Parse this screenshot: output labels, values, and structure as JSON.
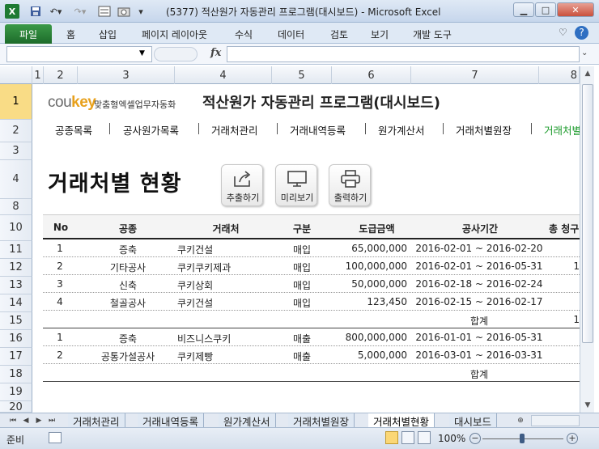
{
  "window": {
    "title": "(5377) 적산원가 자동관리 프로그램(대시보드) - Microsoft Excel",
    "icon": "excel-icon"
  },
  "ribbon": {
    "file_tab": "파일",
    "tabs": [
      "홈",
      "삽입",
      "페이지 레이아웃",
      "수식",
      "데이터",
      "검토",
      "보기",
      "개발 도구"
    ]
  },
  "formula_bar": {
    "fx": "fx",
    "name_box": "",
    "value": ""
  },
  "columns": [
    "1",
    "2",
    "3",
    "4",
    "5",
    "6",
    "7",
    "8"
  ],
  "rows": [
    "1",
    "2",
    "3",
    "4",
    "8",
    "10",
    "11",
    "12",
    "13",
    "14",
    "15",
    "16",
    "17",
    "18",
    "19",
    "20"
  ],
  "header": {
    "logo_main": "cou",
    "logo_accent": "key",
    "logo_sub": "맞춤형엑셀업무자동화",
    "title": "적산원가 자동관리 프로그램(대시보드)"
  },
  "menu": [
    "공종목록",
    "공사원가목록",
    "거래처관리",
    "거래내역등록",
    "원가계산서",
    "거래처별원장",
    "거래처별"
  ],
  "page_title": "거래처별 현황",
  "actions": {
    "export": "추출하기",
    "preview": "미리보기",
    "print": "출력하기"
  },
  "table": {
    "headers": [
      "No",
      "공종",
      "거래처",
      "구분",
      "도급금액",
      "공사기간",
      "총 청구"
    ],
    "rows": [
      {
        "no": "1",
        "type": "증축",
        "vendor": "쿠키건설",
        "kind": "매입",
        "amount": "65,000,000",
        "period": "2016-02-01 ~ 2016-02-20",
        "extra": ""
      },
      {
        "no": "2",
        "type": "기타공사",
        "vendor": "쿠키쿠키제과",
        "kind": "매입",
        "amount": "100,000,000",
        "period": "2016-02-01 ~ 2016-05-31",
        "extra": "1"
      },
      {
        "no": "3",
        "type": "신축",
        "vendor": "쿠키상회",
        "kind": "매입",
        "amount": "50,000,000",
        "period": "2016-02-18 ~ 2016-02-24",
        "extra": ""
      },
      {
        "no": "4",
        "type": "철골공사",
        "vendor": "쿠키건설",
        "kind": "매입",
        "amount": "123,450",
        "period": "2016-02-15 ~ 2016-02-17",
        "extra": ""
      },
      {
        "no": "",
        "type": "",
        "vendor": "",
        "kind": "",
        "amount": "",
        "period": "합계",
        "extra": "1"
      },
      {
        "no": "1",
        "type": "증축",
        "vendor": "비즈니스쿠키",
        "kind": "매출",
        "amount": "800,000,000",
        "period": "2016-01-01 ~ 2016-05-31",
        "extra": ""
      },
      {
        "no": "2",
        "type": "공통가설공사",
        "vendor": "쿠키제빵",
        "kind": "매출",
        "amount": "5,000,000",
        "period": "2016-03-01 ~ 2016-03-31",
        "extra": ""
      },
      {
        "no": "",
        "type": "",
        "vendor": "",
        "kind": "",
        "amount": "",
        "period": "합계",
        "extra": ""
      }
    ]
  },
  "sheets": [
    "거래처관리",
    "거래내역등록",
    "원가계산서",
    "거래처별원장",
    "거래처별현황",
    "대시보드"
  ],
  "active_sheet": "거래처별현황",
  "status": {
    "mode": "준비",
    "zoom": "100%"
  }
}
